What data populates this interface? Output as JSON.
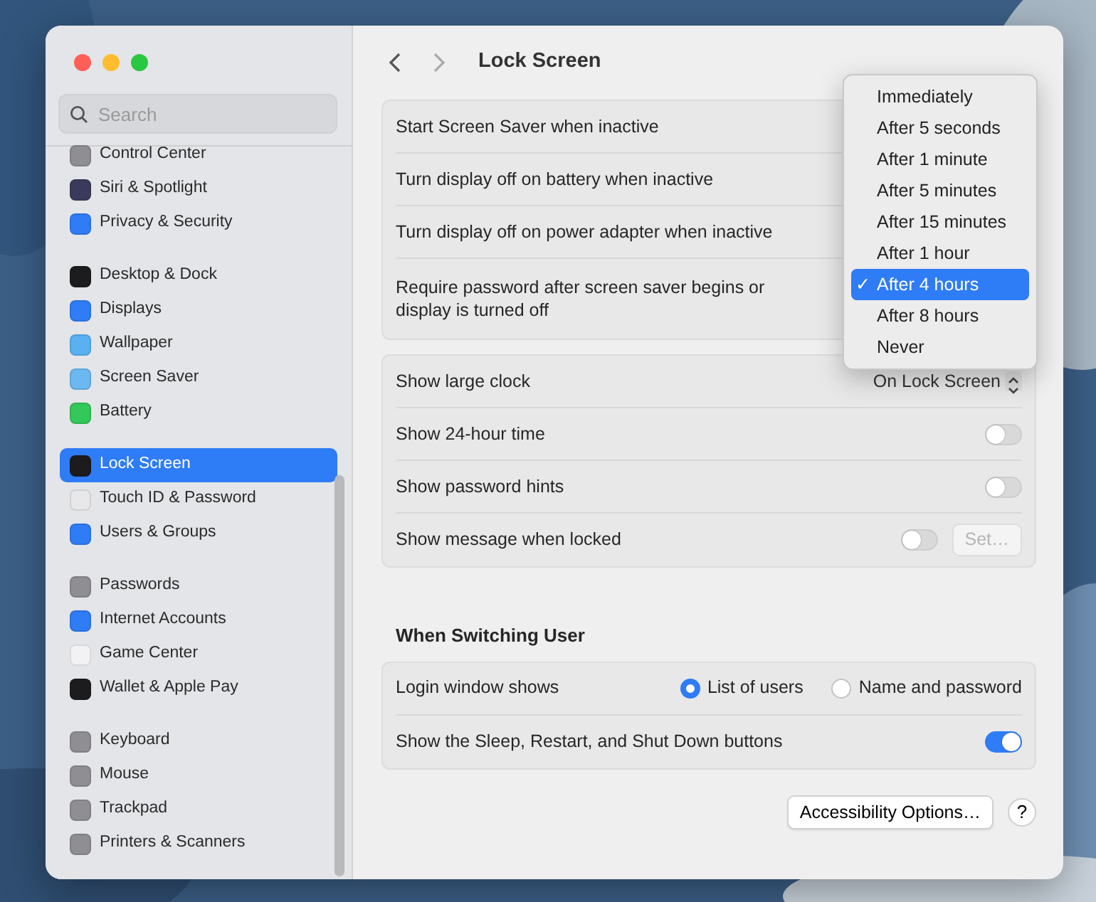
{
  "window": {
    "title": "Lock Screen"
  },
  "sidebar": {
    "search": {
      "placeholder": "Search"
    },
    "groups": [
      [
        {
          "label": "Control Center",
          "color": "#8e8e93",
          "selected": false
        },
        {
          "label": "Siri & Spotlight",
          "color": "#3a3a5c",
          "selected": false
        },
        {
          "label": "Privacy & Security",
          "color": "#2f7cf6",
          "selected": false
        }
      ],
      [
        {
          "label": "Desktop & Dock",
          "color": "#1c1c1e",
          "selected": false
        },
        {
          "label": "Displays",
          "color": "#2f7cf6",
          "selected": false
        },
        {
          "label": "Wallpaper",
          "color": "#5ab0f0",
          "selected": false
        },
        {
          "label": "Screen Saver",
          "color": "#6cb8f0",
          "selected": false
        },
        {
          "label": "Battery",
          "color": "#34c759",
          "selected": false
        }
      ],
      [
        {
          "label": "Lock Screen",
          "color": "#1c1c1e",
          "selected": true
        },
        {
          "label": "Touch ID & Password",
          "color": "#e8e8ea",
          "selected": false
        },
        {
          "label": "Users & Groups",
          "color": "#2f7cf6",
          "selected": false
        }
      ],
      [
        {
          "label": "Passwords",
          "color": "#8e8e93",
          "selected": false
        },
        {
          "label": "Internet Accounts",
          "color": "#2f7cf6",
          "selected": false
        },
        {
          "label": "Game Center",
          "color": "#f2f2f4",
          "selected": false
        },
        {
          "label": "Wallet & Apple Pay",
          "color": "#1c1c1e",
          "selected": false
        }
      ],
      [
        {
          "label": "Keyboard",
          "color": "#8e8e93",
          "selected": false
        },
        {
          "label": "Mouse",
          "color": "#8e8e93",
          "selected": false
        },
        {
          "label": "Trackpad",
          "color": "#8e8e93",
          "selected": false
        },
        {
          "label": "Printers & Scanners",
          "color": "#8e8e93",
          "selected": false
        }
      ]
    ]
  },
  "groups": [
    {
      "rows": [
        {
          "kind": "plain",
          "label": "Start Screen Saver when inactive"
        },
        {
          "kind": "plain",
          "label": "Turn display off on battery when inactive"
        },
        {
          "kind": "plain",
          "label": "Turn display off on power adapter when inactive"
        },
        {
          "kind": "plain",
          "label": "Require password after screen saver begins or display is turned off"
        }
      ]
    },
    {
      "rows": [
        {
          "kind": "popup",
          "label": "Show large clock",
          "value": "On Lock Screen"
        },
        {
          "kind": "toggle",
          "label": "Show 24-hour time",
          "on": false
        },
        {
          "kind": "toggle",
          "label": "Show password hints",
          "on": false
        },
        {
          "kind": "toggle_button",
          "label": "Show message when locked",
          "on": false,
          "button": {
            "label": "Set…",
            "disabled": true
          }
        }
      ]
    },
    {
      "heading": "When Switching User",
      "rows": [
        {
          "kind": "radio",
          "label": "Login window shows",
          "options": [
            {
              "label": "List of users",
              "selected": true
            },
            {
              "label": "Name and password",
              "selected": false
            }
          ]
        },
        {
          "kind": "toggle",
          "label": "Show the Sleep, Restart, and Shut Down buttons",
          "on": true
        }
      ]
    }
  ],
  "footer": {
    "button": "Accessibility Options…",
    "help": "?"
  },
  "popup_menu": {
    "items": [
      {
        "label": "Immediately",
        "selected": false
      },
      {
        "label": "After 5 seconds",
        "selected": false
      },
      {
        "label": "After 1 minute",
        "selected": false
      },
      {
        "label": "After 5 minutes",
        "selected": false
      },
      {
        "label": "After 15 minutes",
        "selected": false
      },
      {
        "label": "After 1 hour",
        "selected": false
      },
      {
        "label": "After 4 hours",
        "selected": true
      },
      {
        "label": "After 8 hours",
        "selected": false
      },
      {
        "label": "Never",
        "selected": false
      }
    ],
    "check": "✓"
  }
}
